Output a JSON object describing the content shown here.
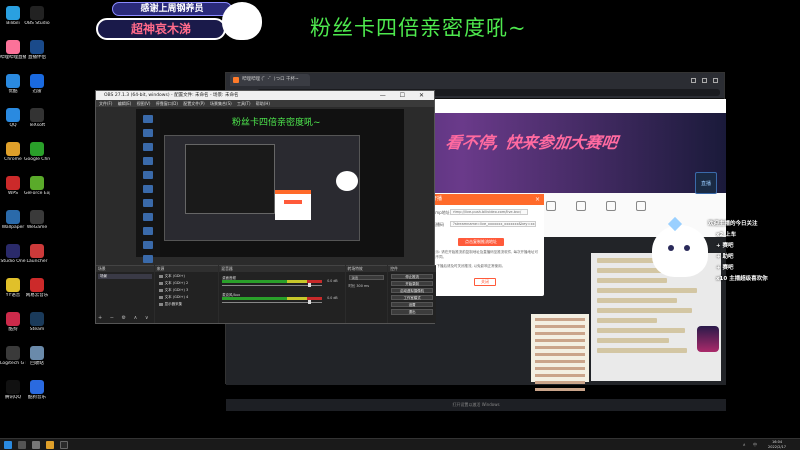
{
  "overlay": {
    "banner_top": "感谢上周钢养员",
    "banner_main": "超神哀木涕",
    "title": "粉丝卡四倍亲密度吼~"
  },
  "desktop_icons": [
    {
      "label": "Bilibili",
      "color": "#2aa0e0"
    },
    {
      "label": "OBS Studio",
      "color": "#222"
    },
    {
      "label": "哔哩哔哩直播姬",
      "color": "#fb7299"
    },
    {
      "label": "直播伴侣",
      "color": "#1a4a8a"
    },
    {
      "label": "优酷",
      "color": "#2a8ae0"
    },
    {
      "label": "迅雷",
      "color": "#1a6ae0"
    },
    {
      "label": "QQ",
      "color": "#2a8ae0"
    },
    {
      "label": "TeXsoft",
      "color": "#333"
    },
    {
      "label": "Chrome",
      "color": "#e0a02a"
    },
    {
      "label": "Google Chrome",
      "color": "#2aa02a"
    },
    {
      "label": "WPS",
      "color": "#cc2a2a"
    },
    {
      "label": "GeForce Experience",
      "color": "#5aaa2a"
    },
    {
      "label": "Wallpaper",
      "color": "#2a6aaa"
    },
    {
      "label": "WeGame",
      "color": "#3a3a3a"
    },
    {
      "label": "Studio One",
      "color": "#2a2a6a"
    },
    {
      "label": "Launcher",
      "color": "#cc3a3a"
    },
    {
      "label": "YY语音",
      "color": "#e0c02a"
    },
    {
      "label": "网易云音乐",
      "color": "#cc2a2a"
    },
    {
      "label": "酷狗",
      "color": "#cc2a4a"
    },
    {
      "label": "Steam",
      "color": "#1a3a5a"
    },
    {
      "label": "Logitech G HUB",
      "color": "#3a3a3a"
    },
    {
      "label": "回收站",
      "color": "#6a8aaa"
    },
    {
      "label": "腾讯QQ",
      "color": "#111"
    },
    {
      "label": "酷狗音乐",
      "color": "#2a6ae0"
    }
  ],
  "browser": {
    "tab_title": "哔哩哔哩 (゜-゜)つロ 干杯~",
    "hero_text": "看不停, 快来参加大赛吧",
    "bottom_text": "打开设置以激活 Windows"
  },
  "dialog": {
    "title": "开播",
    "close": "×",
    "label_server": "rtmp地址",
    "server_value": "rtmp://live-push.bilivideo.com/live-bvc/",
    "label_key": "直播码",
    "key_value": "?streamname=live_xxxxxxx_xxxxxxx&key=xxxxxxxx",
    "main_button": "点击复制推流地址",
    "note1": "提示: 请在开始推流前复制地址及直播码至推流软件, 每次开播地址可能不同。",
    "note2": "2. 下播后请及时关闭推流, 以免影响正常使用。",
    "ok_button": "关闭"
  },
  "obs": {
    "title": "OBS 27.1.3 (64-bit, windows) - 配置文件: 未命名 - 场景: 未命名",
    "menu": "文件(F) 编辑(E) 视图(V) 停靠窗口(D) 配置文件(P) 场景集合(S) 工具(T) 帮助(H)",
    "window_controls": "— ☐ ✕",
    "preview_title": "粉丝卡四倍亲密度吼~",
    "docks": {
      "scenes": "场景",
      "sources": "来源",
      "mixer": "混音器",
      "transitions": "转场特效",
      "controls": "控件"
    },
    "scenes": [
      "场景"
    ],
    "sources": [
      "文本 (GDI+)",
      "文本 (GDI+) 2",
      "文本 (GDI+) 3",
      "文本 (GDI+) 4",
      "显示器采集"
    ],
    "mixer": [
      {
        "name": "桌面音频",
        "db": "0.0 dB",
        "knob": 0.86
      },
      {
        "name": "麦克风/Aux",
        "db": "0.0 dB",
        "knob": 0.86
      }
    ],
    "transition": {
      "selected": "淡出",
      "duration_label": "时长",
      "duration_value": "300 ms"
    },
    "controls": [
      "停止推流",
      "开始录制",
      "启动虚拟摄像机",
      "工作室模式",
      "设置",
      "退出"
    ],
    "footer": "+ − ⚙ ∧ ∨"
  },
  "chat_overlay": [
    {
      "pill": "",
      "text": "欢迎主播的今日关注",
      "gift": ""
    },
    {
      "pill": "",
      "text": "x2 上车",
      "gift": ""
    },
    {
      "pill": "",
      "text": "+ 赛吧",
      "gift": ""
    },
    {
      "pill": "",
      "text": "+ 助吧",
      "gift": ""
    },
    {
      "pill": "",
      "text": "+ 赛吧",
      "gift": ""
    },
    {
      "pill": "",
      "text": "x10 主播超级喜欢你",
      "gift": ""
    }
  ],
  "corner_btn": "直播",
  "taskbar": {
    "time": "16:04",
    "date": "2022/2/17",
    "tray": "∧ 中"
  }
}
